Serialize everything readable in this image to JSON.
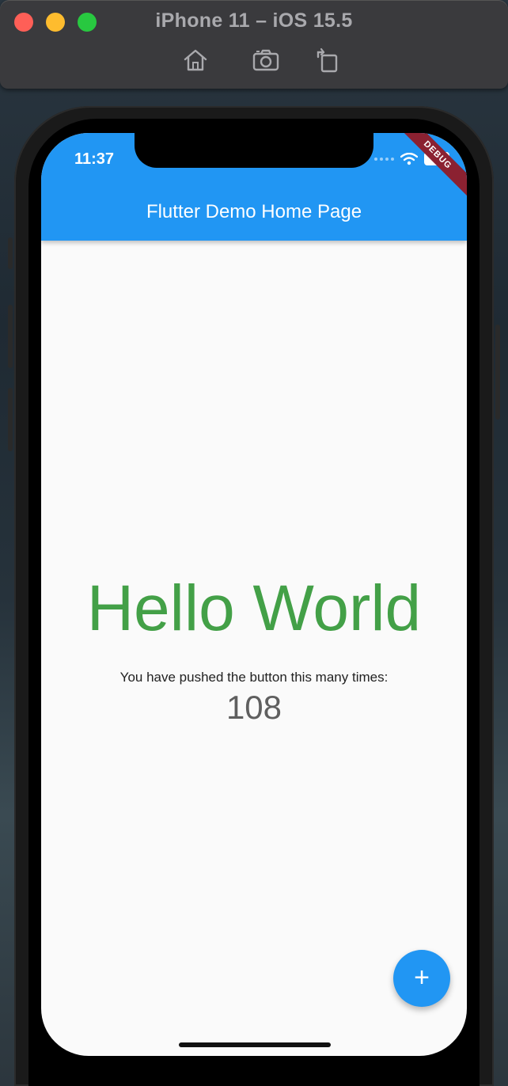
{
  "simulator": {
    "title": "iPhone 11 – iOS 15.5",
    "toolbar": {
      "home_icon": "home-icon",
      "screenshot_icon": "camera-icon",
      "rotate_icon": "rotate-icon"
    }
  },
  "status_bar": {
    "time": "11:37",
    "icons": [
      "signal-icon",
      "wifi-icon",
      "battery-icon"
    ]
  },
  "app_bar": {
    "title": "Flutter Demo Home Page",
    "color": "#2196f3"
  },
  "debug_banner": {
    "label": "DEBUG",
    "color": "#8b2131"
  },
  "content": {
    "headline": "Hello World",
    "headline_color": "#43a047",
    "counter_label": "You have pushed the button this many times:",
    "counter_value": "108"
  },
  "fab": {
    "icon": "plus-icon",
    "label": "+"
  }
}
